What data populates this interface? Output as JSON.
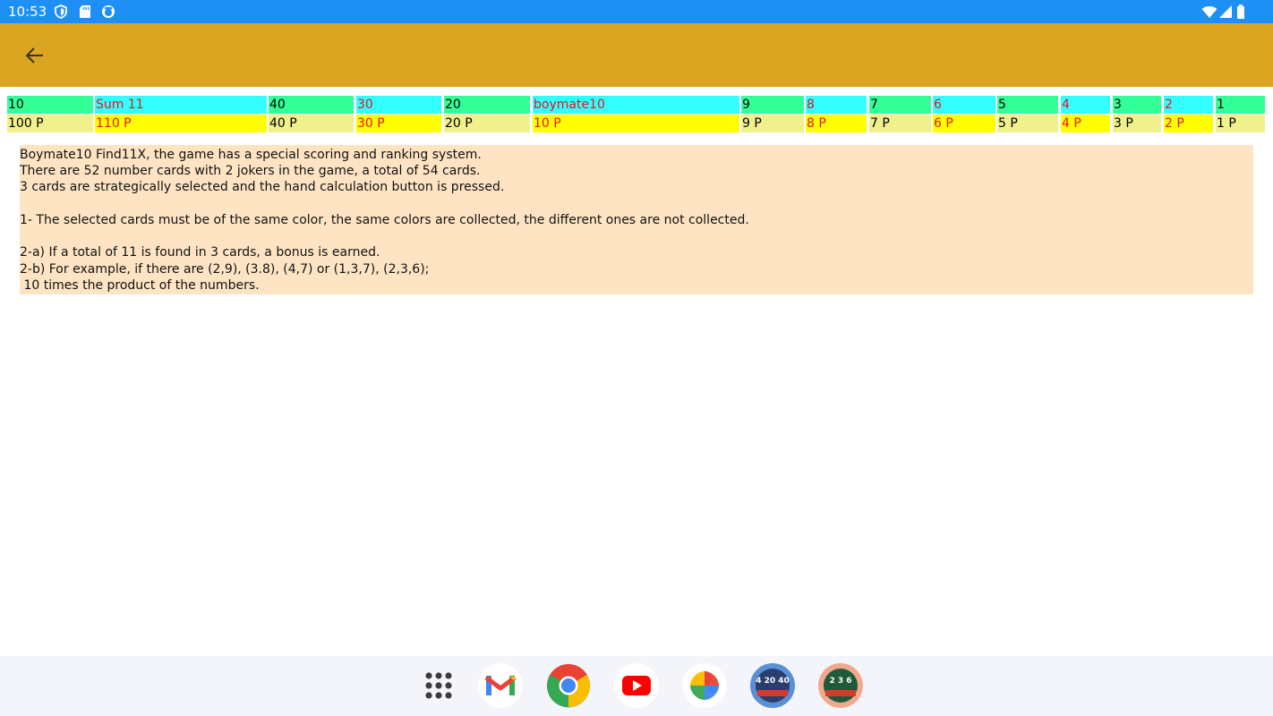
{
  "status_bar": {
    "time": "10:53",
    "left_icons": [
      "shield-icon",
      "sd-card-icon",
      "app-notification-icon"
    ],
    "right_icons": [
      "wifi-icon",
      "signal-icon",
      "battery-icon"
    ],
    "color": "#1e8ff5"
  },
  "app_bar": {
    "color": "#daa521",
    "back_icon": "arrow-left-icon"
  },
  "score_table": {
    "headers": [
      {
        "label": "10",
        "style": "green"
      },
      {
        "label": "Sum 11",
        "style": "cyan"
      },
      {
        "label": "40",
        "style": "green"
      },
      {
        "label": "30",
        "style": "cyan"
      },
      {
        "label": "20",
        "style": "green"
      },
      {
        "label": "boymate10",
        "style": "cyan"
      },
      {
        "label": "9",
        "style": "green"
      },
      {
        "label": "8",
        "style": "cyan"
      },
      {
        "label": "7",
        "style": "green"
      },
      {
        "label": "6",
        "style": "cyan"
      },
      {
        "label": "5",
        "style": "green"
      },
      {
        "label": "4",
        "style": "cyan"
      },
      {
        "label": "3",
        "style": "green"
      },
      {
        "label": "2",
        "style": "cyan"
      },
      {
        "label": "1",
        "style": "green"
      }
    ],
    "points": [
      {
        "label": "100 P",
        "style": "khaki"
      },
      {
        "label": "110 P",
        "style": "yellow"
      },
      {
        "label": "40 P",
        "style": "khaki"
      },
      {
        "label": "30 P",
        "style": "yellow"
      },
      {
        "label": "20 P",
        "style": "khaki"
      },
      {
        "label": "10 P",
        "style": "yellow"
      },
      {
        "label": "9 P",
        "style": "khaki"
      },
      {
        "label": "8 P",
        "style": "yellow"
      },
      {
        "label": "7 P",
        "style": "khaki"
      },
      {
        "label": "6 P",
        "style": "yellow"
      },
      {
        "label": "5 P",
        "style": "khaki"
      },
      {
        "label": "4 P",
        "style": "yellow"
      },
      {
        "label": "3 P",
        "style": "khaki"
      },
      {
        "label": "2 P",
        "style": "yellow"
      },
      {
        "label": "1 P",
        "style": "khaki"
      }
    ],
    "colors": {
      "green": "#33ff99",
      "cyan": "#33ffff",
      "khaki": "#f0f08c",
      "yellow": "#ffff00",
      "red_text": "#e8141b"
    }
  },
  "rules": {
    "lines": [
      "Boymate10 Find11X, the game has a special scoring and ranking system.",
      "There are 52 number cards with 2 jokers in the game, a total of 54 cards.",
      "3 cards are strategically selected and the hand calculation button is pressed.",
      "",
      "1- The selected cards must be of the same color, the same colors are collected, the different ones are not collected.",
      "",
      "2-a) If a total of 11 is found in 3 cards, a bonus is earned.",
      "2-b) For example, if there are (2,9), (3.8), (4,7) or (1,3,7), (2,3,6);",
      " 10 times the product of the numbers."
    ],
    "background": "#ffe4c4"
  },
  "dock": {
    "apps": [
      {
        "name": "app-drawer-icon"
      },
      {
        "name": "gmail-icon"
      },
      {
        "name": "chrome-icon"
      },
      {
        "name": "youtube-icon"
      },
      {
        "name": "photos-icon"
      },
      {
        "name": "find8x-app-icon",
        "text": "4 20 40"
      },
      {
        "name": "find11x-app-icon",
        "text": "2 3 6"
      }
    ]
  }
}
